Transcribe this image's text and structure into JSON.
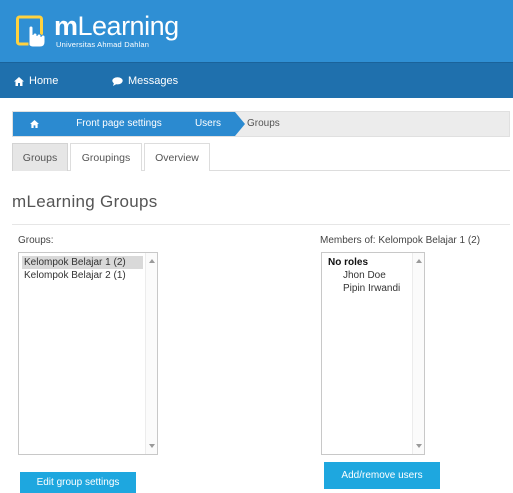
{
  "header": {
    "logo_brand_bold": "m",
    "logo_brand_rest": "Learning",
    "logo_subtitle": "Universitas Ahmad Dahlan"
  },
  "nav": {
    "home_label": "Home",
    "messages_label": "Messages"
  },
  "breadcrumb": {
    "items": [
      "Front page settings",
      "Users"
    ],
    "current": "Groups"
  },
  "tabs": [
    {
      "label": "Groups",
      "active": true
    },
    {
      "label": "Groupings",
      "active": false
    },
    {
      "label": "Overview",
      "active": false
    }
  ],
  "page_title": "mLearning Groups",
  "groups_panel": {
    "label": "Groups:",
    "options": [
      "Kelompok Belajar 1 (2)",
      "Kelompok Belajar 2 (1)"
    ],
    "selected": "Kelompok Belajar 1 (2)",
    "button_label": "Edit group settings"
  },
  "members_panel": {
    "label": "Members of: Kelompok Belajar 1 (2)",
    "role_group": "No roles",
    "members": [
      "Jhon Doe",
      "Pipin Irwandi"
    ],
    "button_label": "Add/remove users"
  },
  "colors": {
    "header_bg": "#2f8fd4",
    "nav_bg": "#1f70ad",
    "breadcrumb_blue": "#2b8ad0",
    "button_bg": "#1ea7df"
  },
  "icons": [
    "logo-hand-icon",
    "home-icon",
    "messages-icon",
    "breadcrumb-home-icon",
    "scroll-up-icon",
    "scroll-down-icon"
  ]
}
